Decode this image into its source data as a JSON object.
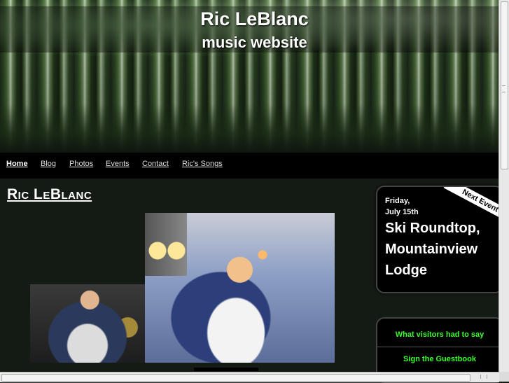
{
  "header": {
    "title": "Ric LeBlanc",
    "subtitle": "music website"
  },
  "nav": {
    "items": [
      {
        "label": "Home",
        "active": true
      },
      {
        "label": "Blog"
      },
      {
        "label": "Photos"
      },
      {
        "label": "Events"
      },
      {
        "label": "Contact"
      },
      {
        "label": "Ric's Songs"
      }
    ]
  },
  "main": {
    "heading": "Ric LeBlanc"
  },
  "next_event": {
    "ribbon": "Next Event",
    "day": "Friday,",
    "date": "July 15th",
    "title": "Ski Roundtop, Mountainview Lodge"
  },
  "guestbook": {
    "visitors_link": "What visitors had to say",
    "sign_link": "Sign the Guestbook",
    "link_color": "#3aff2c"
  }
}
